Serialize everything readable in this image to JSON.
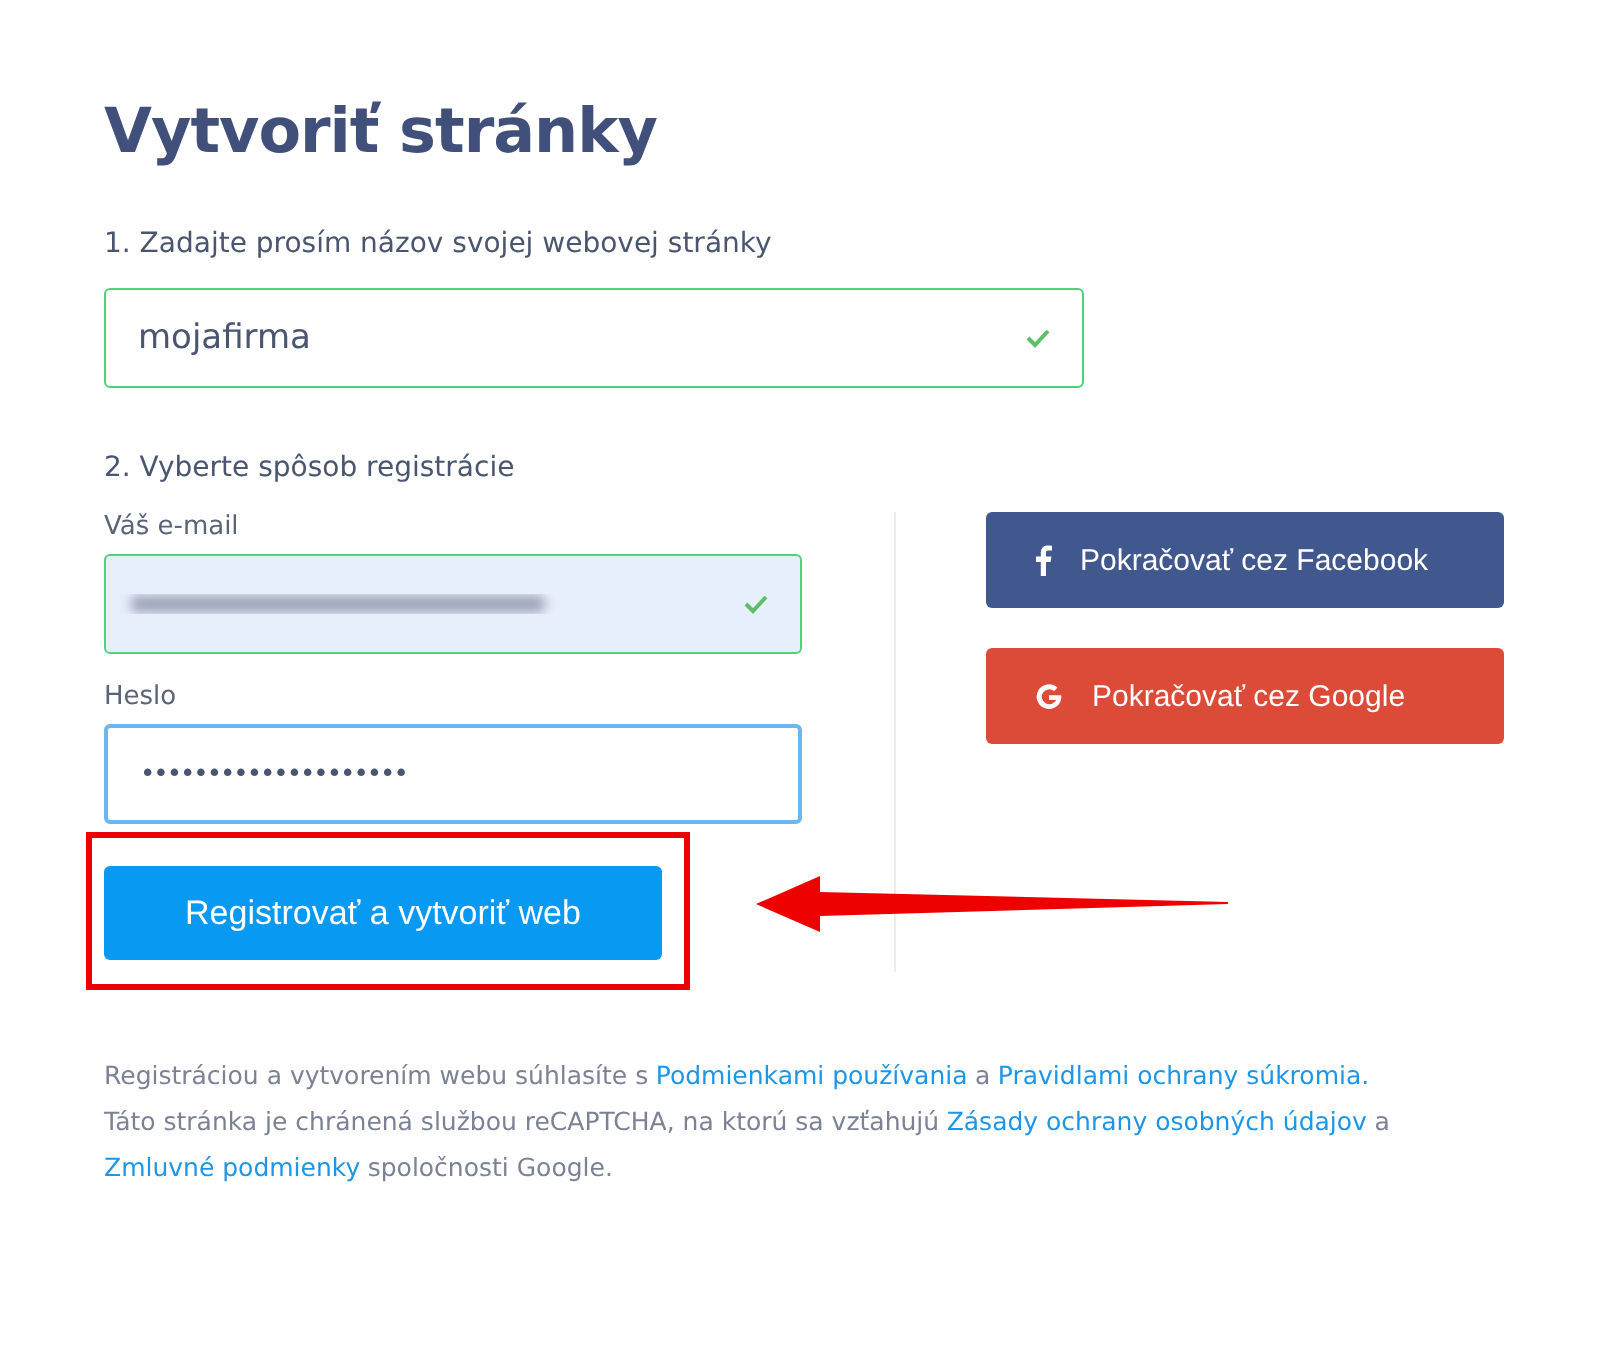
{
  "title": "Vytvoriť stránky",
  "step_1": {
    "label": "1. Zadajte prosím názov svojej webovej stránky",
    "field": {
      "value": "mojafirma",
      "valid": true,
      "focused": false
    }
  },
  "step_2": {
    "label": "2. Vyberte spôsob registrácie",
    "fields": [
      {
        "label": "Váš e-mail",
        "kind": "blurred",
        "valid": true,
        "focused": false
      },
      {
        "label": "Heslo",
        "kind": "password",
        "value": "••••••••••••••••••••",
        "valid": false,
        "focused": true
      }
    ],
    "social_buttons": [
      {
        "kind": "facebook",
        "label": "Pokračovať cez Facebook"
      },
      {
        "kind": "google",
        "label": "Pokračovať cez Google"
      }
    ],
    "submit": {
      "label": "Registrovať a vytvoriť web",
      "highlighted": true
    }
  },
  "legal": [
    [
      {
        "text": "Registráciou a vytvorením webu súhlasíte s",
        "kind": "text"
      },
      {
        "text": "Podmienkami používania",
        "kind": "link"
      },
      {
        "text": "a",
        "kind": "text"
      },
      {
        "text": "Pravidlami ochrany súkromia.",
        "kind": "link"
      }
    ],
    [
      {
        "text": "Táto stránka je chránená službou reCAPTCHA, na ktorú sa vzťahujú",
        "kind": "text"
      },
      {
        "text": "Zásady ochrany osobných údajov",
        "kind": "link"
      },
      {
        "text": "a",
        "kind": "text"
      }
    ],
    [
      {
        "text": "Zmluvné podmienky",
        "kind": "link"
      },
      {
        "text": "spoločnosti Google.",
        "kind": "text"
      }
    ]
  ]
}
